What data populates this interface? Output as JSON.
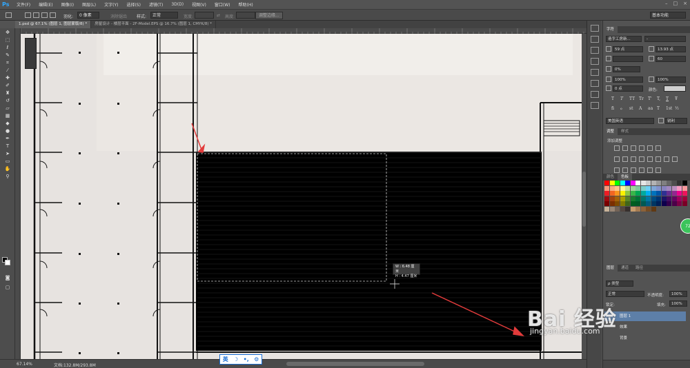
{
  "app": {
    "logo": "Ps"
  },
  "menu": [
    "文件(F)",
    "编辑(E)",
    "图像(I)",
    "图层(L)",
    "文字(Y)",
    "选择(S)",
    "滤镜(T)",
    "3D(D)",
    "视图(V)",
    "窗口(W)",
    "帮助(H)"
  ],
  "window_controls": [
    "–",
    "□",
    "×"
  ],
  "options": {
    "feather_label": "羽化:",
    "feather_value": "0 像素",
    "antialias_label": "消除锯齿",
    "style_label": "样式:",
    "style_value": "正常",
    "width_label": "宽度:",
    "height_label": "高度:",
    "refine_button": "调整边缘...",
    "workspace": "基本功能"
  },
  "tabs": [
    {
      "label": "1.psd @ 67.1% (图层 1, 图层蒙版/8) *",
      "active": true
    },
    {
      "label": "房屋设计 - 楼层平面 - 2F-Model.EPS @ 16.7% (图层 1, CMYK/8) *",
      "active": false
    }
  ],
  "info_popup": {
    "w": "W : 6.48 厘米",
    "h": "H : 4.47 厘米"
  },
  "status": {
    "zoom": "67.14%",
    "doc": "文档:132.8M/293.8M"
  },
  "ime": [
    "英",
    "☽",
    "•,",
    "⚙"
  ],
  "character_panel": {
    "tab": "字符",
    "font_family": "造字工房新...",
    "font_style": "-",
    "size": "59 点",
    "leading": "13.93 点",
    "tracking": "60",
    "scale_label": "0%",
    "vscale": "100%",
    "hscale": "100%",
    "baseline": "0 点",
    "color_label": "颜色:",
    "language": "美国英语",
    "aa": "锐利",
    "glyphs": [
      "T",
      "T",
      "TT",
      "Tr",
      "T'",
      "T,",
      "T",
      "Ŧ"
    ],
    "ligatures": [
      "fi",
      "ℴ",
      "st",
      "A",
      "aa",
      "T",
      "1st",
      "½"
    ]
  },
  "adjust_panel": {
    "tabs": [
      "调整",
      "样式"
    ],
    "title": "添加调整"
  },
  "swatch_panel": {
    "tabs": [
      "颜色",
      "色板"
    ]
  },
  "layers_panel": {
    "tabs": [
      "图层",
      "通道",
      "路径"
    ],
    "filter": "ρ 类型",
    "blend": "正常",
    "opacity_label": "不透明度:",
    "opacity": "100%",
    "lock_label": "锁定:",
    "fill_label": "填充:",
    "fill": "100%",
    "rows": [
      {
        "name": "图层 1"
      },
      {
        "name": "效果"
      },
      {
        "name": "背景"
      }
    ]
  },
  "badge": "72",
  "watermark": {
    "brand": "Bai 经验",
    "url": "jingyan.baidu.com"
  },
  "colors": {
    "selection_fill": "#000000",
    "canvas_bg": "#e7e3e0",
    "arrow": "#e23b3b",
    "accent": "#31a8ff"
  }
}
